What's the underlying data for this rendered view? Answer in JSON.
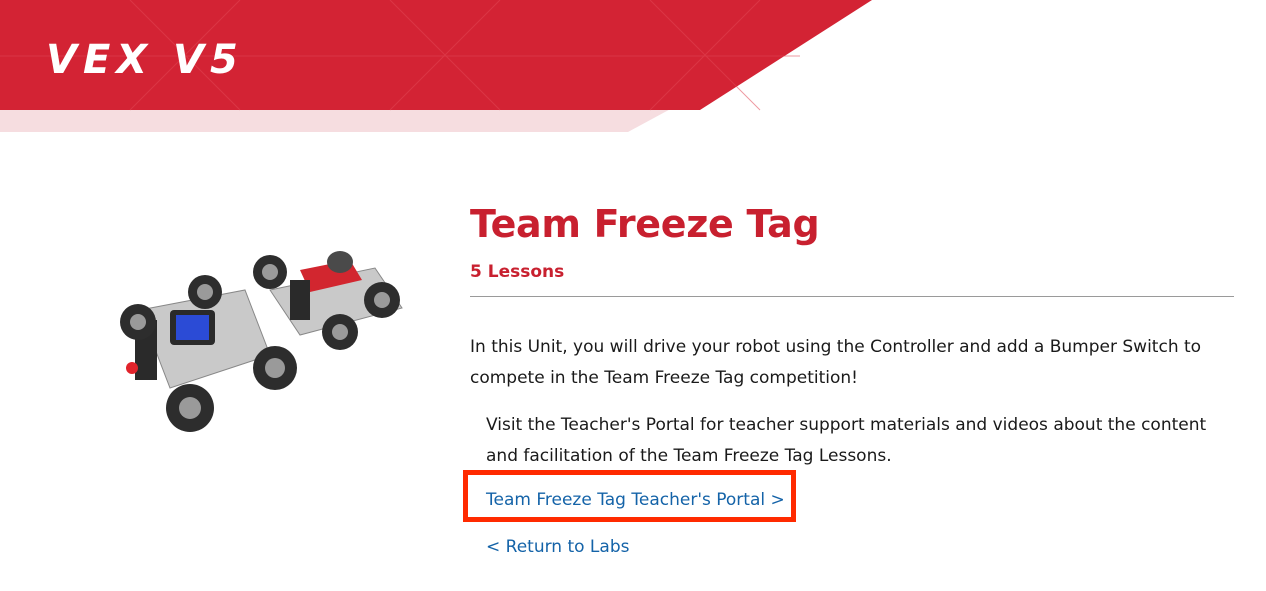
{
  "brand": {
    "logo": "VEX V5",
    "accent": "#d32334"
  },
  "unit": {
    "title": "Team Freeze Tag",
    "lessons": "5 Lessons",
    "description": "In this Unit, you will drive your robot using the Controller and add a Bumper Switch to compete in the Team Freeze Tag competition!",
    "portal_note": "Visit the Teacher's Portal for teacher support materials and videos about the content and facilitation of the Team Freeze Tag Lessons."
  },
  "links": {
    "portal": "Team Freeze Tag Teacher's Portal  >",
    "return": "<  Return to Labs"
  },
  "image": {
    "subject": "two V5 clawbot robots"
  }
}
